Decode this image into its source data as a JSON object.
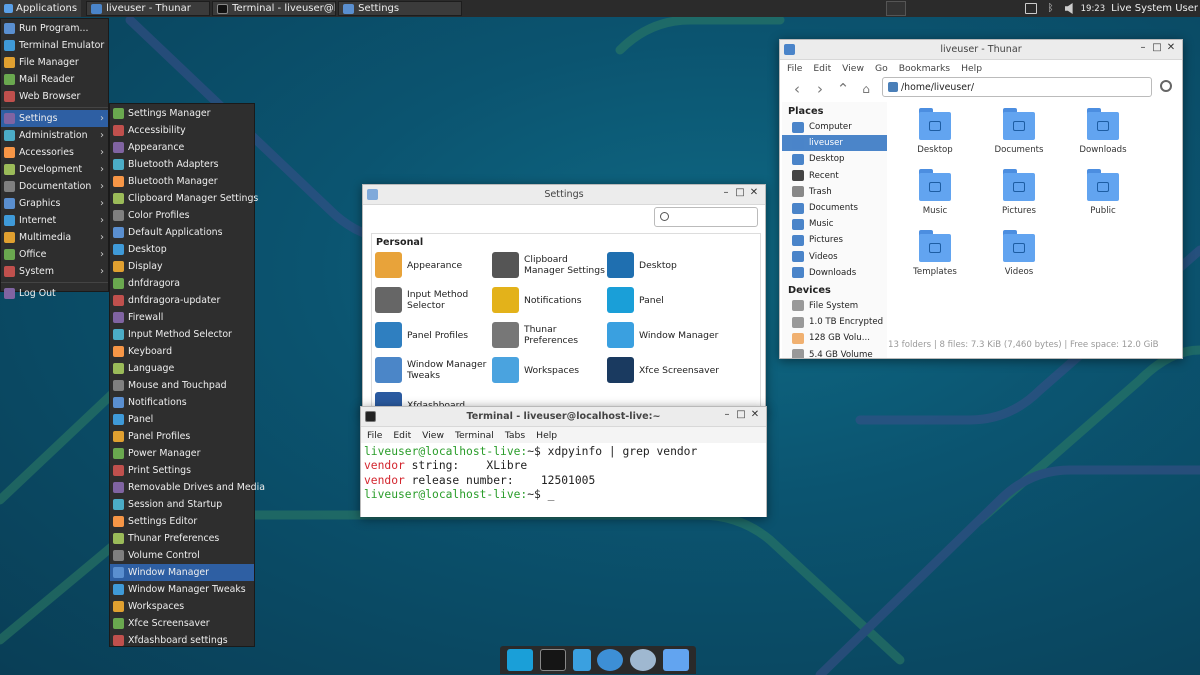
{
  "top_panel": {
    "applications_label": "Applications",
    "tasks": [
      {
        "label": "liveuser - Thunar",
        "icon": "folder-icon",
        "color": "#4a84c9"
      },
      {
        "label": "Terminal - liveuser@localh...",
        "icon": "terminal-icon",
        "color": "#333333"
      },
      {
        "label": "Settings",
        "icon": "settings-icon",
        "color": "#5a8fd0"
      }
    ],
    "clock": "19:23",
    "user": "Live System User"
  },
  "app_menu": {
    "items": [
      {
        "label": "Run Program...",
        "icon": "run-icon"
      },
      {
        "label": "Terminal Emulator",
        "icon": "terminal-icon"
      },
      {
        "label": "File Manager",
        "icon": "file-manager-icon"
      },
      {
        "label": "Mail Reader",
        "icon": "mail-icon"
      },
      {
        "label": "Web Browser",
        "icon": "browser-icon"
      },
      {
        "label": "Settings",
        "icon": "settings-icon",
        "submenu": true,
        "active": true
      },
      {
        "label": "Administration",
        "icon": "administration-icon",
        "submenu": true
      },
      {
        "label": "Accessories",
        "icon": "accessories-icon",
        "submenu": true
      },
      {
        "label": "Development",
        "icon": "development-icon",
        "submenu": true
      },
      {
        "label": "Documentation",
        "icon": "documentation-icon",
        "submenu": true
      },
      {
        "label": "Graphics",
        "icon": "graphics-icon",
        "submenu": true
      },
      {
        "label": "Internet",
        "icon": "internet-icon",
        "submenu": true
      },
      {
        "label": "Multimedia",
        "icon": "multimedia-icon",
        "submenu": true
      },
      {
        "label": "Office",
        "icon": "office-icon",
        "submenu": true
      },
      {
        "label": "System",
        "icon": "system-icon",
        "submenu": true
      },
      {
        "label": "Log Out",
        "icon": "logout-icon"
      }
    ]
  },
  "settings_submenu": {
    "items": [
      "Settings Manager",
      "Accessibility",
      "Appearance",
      "Bluetooth Adapters",
      "Bluetooth Manager",
      "Clipboard Manager Settings",
      "Color Profiles",
      "Default Applications",
      "Desktop",
      "Display",
      "dnfdragora",
      "dnfdragora-updater",
      "Firewall",
      "Input Method Selector",
      "Keyboard",
      "Language",
      "Mouse and Touchpad",
      "Notifications",
      "Panel",
      "Panel Profiles",
      "Power Manager",
      "Print Settings",
      "Removable Drives and Media",
      "Session and Startup",
      "Settings Editor",
      "Thunar Preferences",
      "Volume Control",
      "Window Manager",
      "Window Manager Tweaks",
      "Workspaces",
      "Xfce Screensaver",
      "Xfdashboard settings"
    ],
    "active_index": 27
  },
  "settings_window": {
    "title": "Settings",
    "section": "Personal",
    "items": [
      {
        "label": "Appearance",
        "icon": "appearance-icon"
      },
      {
        "label": "Clipboard Manager Settings",
        "icon": "clipboard-icon"
      },
      {
        "label": "Desktop",
        "icon": "desktop-icon"
      },
      {
        "label": "Input Method Selector",
        "icon": "keyboard-icon"
      },
      {
        "label": "Notifications",
        "icon": "bell-icon"
      },
      {
        "label": "Panel",
        "icon": "panel-icon"
      },
      {
        "label": "Panel Profiles",
        "icon": "panel-profiles-icon"
      },
      {
        "label": "Thunar Preferences",
        "icon": "thunar-icon"
      },
      {
        "label": "Window Manager",
        "icon": "window-manager-icon"
      },
      {
        "label": "Window Manager Tweaks",
        "icon": "tweaks-icon"
      },
      {
        "label": "Workspaces",
        "icon": "workspaces-icon"
      },
      {
        "label": "Xfce Screensaver",
        "icon": "screensaver-icon"
      },
      {
        "label": "Xfdashboard",
        "icon": "xfdashboard-icon"
      }
    ]
  },
  "terminal": {
    "title": "Terminal - liveuser@localhost-live:~",
    "menu": [
      "File",
      "Edit",
      "View",
      "Terminal",
      "Tabs",
      "Help"
    ],
    "lines": [
      {
        "prompt": "liveuser@localhost-live:",
        "path": "~",
        "cmd": "$ xdpyinfo | grep vendor"
      },
      {
        "red": "vendor",
        "rest": " string:    XLibre"
      },
      {
        "red": "vendor",
        "rest": " release number:    12501005"
      },
      {
        "prompt": "liveuser@localhost-live:",
        "path": "~",
        "cmd": "$ _"
      }
    ]
  },
  "thunar": {
    "title": "liveuser - Thunar",
    "menu": [
      "File",
      "Edit",
      "View",
      "Go",
      "Bookmarks",
      "Help"
    ],
    "path": "/home/liveuser/",
    "places_header": "Places",
    "places": [
      {
        "label": "Computer",
        "color": "#4a84c9"
      },
      {
        "label": "liveuser",
        "color": "#4a84c9",
        "active": true
      },
      {
        "label": "Desktop",
        "color": "#4a84c9"
      },
      {
        "label": "Recent",
        "color": "#444444"
      },
      {
        "label": "Trash",
        "color": "#888888"
      },
      {
        "label": "Documents",
        "color": "#4a84c9"
      },
      {
        "label": "Music",
        "color": "#4a84c9"
      },
      {
        "label": "Pictures",
        "color": "#4a84c9"
      },
      {
        "label": "Videos",
        "color": "#4a84c9"
      },
      {
        "label": "Downloads",
        "color": "#4a84c9"
      }
    ],
    "devices_header": "Devices",
    "devices": [
      {
        "label": "File System",
        "color": "#999999"
      },
      {
        "label": "1.0 TB Encrypted",
        "color": "#999999"
      },
      {
        "label": "128 GB Volu...",
        "color": "#f0b070"
      },
      {
        "label": "5.4 GB Volume",
        "color": "#999999"
      }
    ],
    "folders": [
      "Desktop",
      "Documents",
      "Downloads",
      "Music",
      "Pictures",
      "Public",
      "Templates",
      "Videos"
    ],
    "status": "13 folders  |  8 files: 7.3 KiB (7,460 bytes)  |  Free space: 12.0 GiB"
  }
}
